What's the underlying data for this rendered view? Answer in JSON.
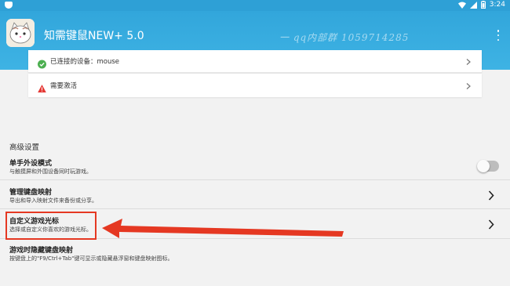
{
  "status_bar": {
    "time": "3:24"
  },
  "app_bar": {
    "title": "知需键鼠NEW+ 5.0",
    "watermark": "一 qq内部群 1059714285",
    "more_icon": "more-vert-icon"
  },
  "cards": [
    {
      "icon": "check-circle-icon",
      "label": "已连接的设备：mouse",
      "color": "#4caf50"
    },
    {
      "icon": "warning-icon",
      "label": "需要激活",
      "color": "#e53935"
    }
  ],
  "advanced": {
    "section_title": "高级设置",
    "items": [
      {
        "title": "单手外设模式",
        "subtitle": "与触摸屏和外围设备同时玩游戏。",
        "control": "toggle",
        "toggle_on": false
      },
      {
        "title": "管理键盘映射",
        "subtitle": "导出和导入映射文件来备份或分享。",
        "control": "chevron"
      },
      {
        "title": "自定义游戏光标",
        "subtitle": "选择或自定义你喜欢的游戏光标。",
        "control": "chevron"
      },
      {
        "title": "游戏时隐藏键盘映射",
        "subtitle": "按键盘上的\"F9/Ctrl+Tab\"键可显示或隐藏悬浮窗和键盘映射图标。",
        "control": "none"
      }
    ]
  },
  "annotation": {
    "color": "#e53822"
  }
}
